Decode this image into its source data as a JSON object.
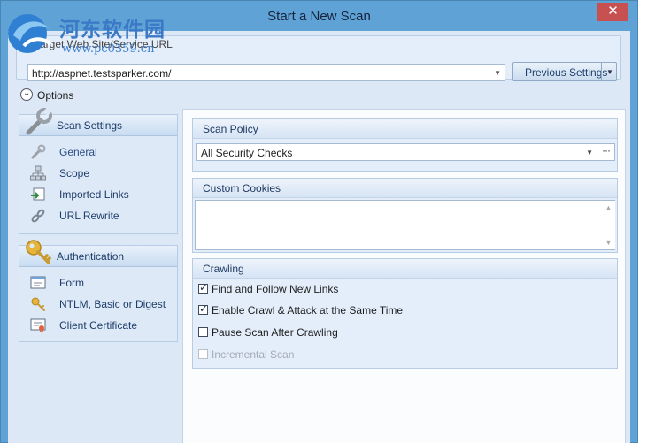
{
  "window": {
    "title": "Start a New Scan",
    "close_glyph": "✕"
  },
  "watermark": {
    "text": "河东软件园",
    "url": "www.pc0359.cn"
  },
  "target": {
    "group_label": "Target Web Site/Service URL",
    "url_value": "http://aspnet.testsparker.com/",
    "previous_settings_label": "Previous Settings"
  },
  "options": {
    "label": "Options"
  },
  "nav": {
    "scan_settings": {
      "header": "Scan Settings",
      "items": [
        {
          "label": "General",
          "icon": "wrench-icon"
        },
        {
          "label": "Scope",
          "icon": "sitemap-icon"
        },
        {
          "label": "Imported Links",
          "icon": "import-icon"
        },
        {
          "label": "URL Rewrite",
          "icon": "link-gear-icon"
        }
      ]
    },
    "authentication": {
      "header": "Authentication",
      "items": [
        {
          "label": "Form",
          "icon": "form-icon"
        },
        {
          "label": "NTLM, Basic or Digest",
          "icon": "key-icon"
        },
        {
          "label": "Client Certificate",
          "icon": "certificate-icon"
        }
      ]
    }
  },
  "scan_policy": {
    "title": "Scan Policy",
    "selected": "All Security Checks",
    "more": "···"
  },
  "custom_cookies": {
    "title": "Custom Cookies",
    "value": ""
  },
  "crawling": {
    "title": "Crawling",
    "options": [
      {
        "label": "Find and Follow New Links",
        "checked": true,
        "enabled": true
      },
      {
        "label": "Enable Crawl & Attack at the Same Time",
        "checked": true,
        "enabled": true
      },
      {
        "label": "Pause Scan After Crawling",
        "checked": false,
        "enabled": true
      },
      {
        "label": "Incremental Scan",
        "checked": false,
        "enabled": false
      }
    ]
  }
}
